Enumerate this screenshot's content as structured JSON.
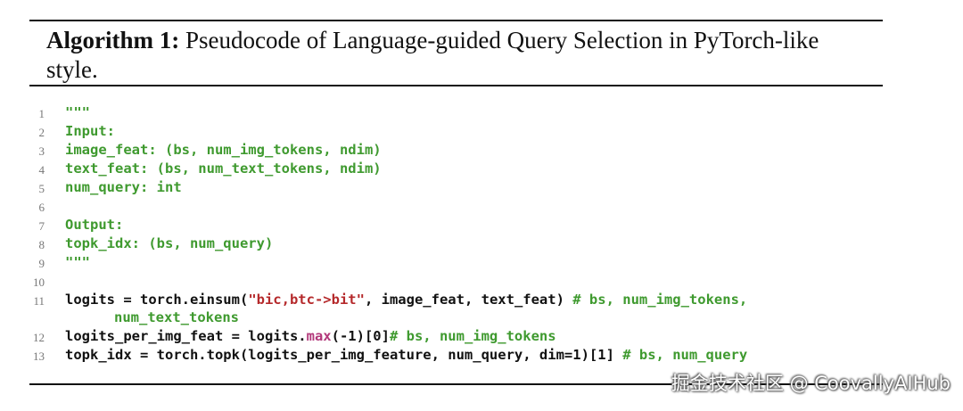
{
  "caption": {
    "label": "Algorithm 1:",
    "text": " Pseudocode of Language-guided Query Selection in PyTorch-like style."
  },
  "code": {
    "line_numbers": [
      "1",
      "2",
      "3",
      "4",
      "5",
      "6",
      "7",
      "8",
      "9",
      "10",
      "11",
      "12",
      "13"
    ],
    "l1": "\"\"\"",
    "l2": "Input:",
    "l3": "image_feat: (bs, num_img_tokens, ndim)",
    "l4": "text_feat: (bs, num_text_tokens, ndim)",
    "l5": "num_query: int",
    "l7": "Output:",
    "l8": "topk_idx: (bs, num_query)",
    "l9": "\"\"\"",
    "l11_a": "logits = torch.einsum(",
    "l11_str": "\"bic,btc->bit\"",
    "l11_b": ", image_feat, text_feat) ",
    "l11_comment": "# bs, num_img_tokens,",
    "l11_cont": "num_text_tokens",
    "l12_a": "logits_per_img_feat = logits.",
    "l12_kw": "max",
    "l12_b": "(-1)[0]",
    "l12_comment": "# bs, num_img_tokens",
    "l13_a": "topk_idx = torch.topk(logits_per_img_feature, num_query, dim=1)[1] ",
    "l13_comment": "# bs, num_query"
  },
  "watermark": "掘金技术社区 @ CoovallyAIHub",
  "colors": {
    "docstring_comment": "#3f9a2f",
    "string": "#b5292b",
    "builtin": "#b2387a"
  }
}
